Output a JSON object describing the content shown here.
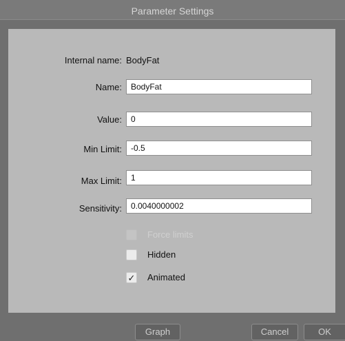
{
  "window": {
    "title": "Parameter Settings"
  },
  "form": {
    "internal_name_label": "Internal name:",
    "internal_name_value": "BodyFat",
    "name_label": "Name:",
    "name_value": "BodyFat",
    "value_label": "Value:",
    "value_value": "0",
    "min_label": "Min Limit:",
    "min_value": "-0.5",
    "max_label": "Max Limit:",
    "max_value": "1",
    "sensitivity_label": "Sensitivity:",
    "sensitivity_value": "0.0040000002"
  },
  "options": {
    "force_limits": {
      "label": "Force limits",
      "checked": false,
      "enabled": false
    },
    "hidden": {
      "label": "Hidden",
      "checked": false,
      "enabled": true
    },
    "animated": {
      "label": "Animated",
      "checked": true,
      "enabled": true
    },
    "check_glyph": "✓"
  },
  "buttons": {
    "graph": "Graph",
    "cancel": "Cancel",
    "ok": "OK"
  }
}
